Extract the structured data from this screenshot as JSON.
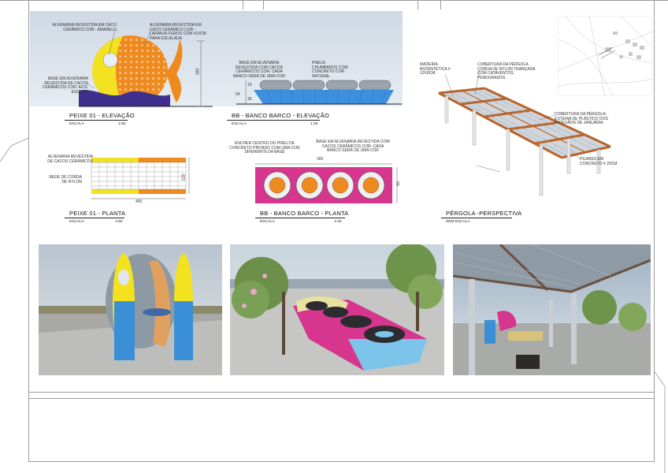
{
  "sheet": {
    "frame_color": "#9a9a9a"
  },
  "peixe_elevacao": {
    "title": "PEIXE 01 - ELEVAÇÃO",
    "scale_label": "ESCALA",
    "scale_value": "1:50",
    "note_eye": "ALVENARIA REVESTIDA EM CACO CERÂMICO COR : AMARELO",
    "note_body": "ALVENARIA REVESTIDA EM CACO CERÂMICO COR : LARANJA FUROS COM #10CM PARA ESCALADA",
    "note_base": "BASE EM ALVENARIA REVESTIDA DE CACOS CERÂMICOS COR: AZUL ESCURO",
    "dim_height": "280"
  },
  "banco_elevacao": {
    "title": "BB - BANCO BARCO - ELEVAÇÃO",
    "scale_label": "ESCALA",
    "scale_value": "1:25",
    "note_base": "BASE EM ALVENARIA REVESTIDA COM CACOS CERÂMICOS COR: CADA BANCO SERÁ DE UMA COR",
    "note_tires": "PNEUS CHUMBADOS COM CONCRETO COR NATURAL",
    "dim_a": "15",
    "dim_b": "54",
    "dim_c": "35"
  },
  "pergola_perspectiva": {
    "title": "PÉRGOLA -PERSPECTIVA",
    "scale_label": "SEM ESCALA",
    "note_wood": "MADEIRA BIOSINTÉTICA # 12X9CM",
    "note_cover": "COBERTURA DA PÉRGOLA CORDA DE NYLON TRANÇADA COM CATAVENTOS PENDURADOS",
    "note_cover2": "COBERTURA DA PÉRGOLA: ESTEIRA DE PLÁSTICO DOS ARTESÃOS DE JANUÁRIA",
    "note_pillars": "PILARES EM CONCRETO # 20CM"
  },
  "peixe_planta": {
    "title": "PEIXE 01 - PLANTA",
    "scale_label": "ESCALA",
    "scale_value": "1:50",
    "note_wall": "ALVENARIA REVESTIDA DE CACOS CERÂMICOS",
    "note_net": "REDE DE CORDA DE NYLON",
    "dim_width": "400",
    "dim_depth": "120"
  },
  "banco_planta": {
    "title": "BB - BANCO BARCO - PLANTA",
    "scale_label": "ESCALA",
    "scale_value": "1:25",
    "note_fill": "ENCHER CENTRO DO PNEU DE CONCRETO PINTADO COM UMA COR DIFERENTE DA BASE",
    "note_base": "BASE EM ALVENARIA REVESTIDA COM CACOS CERÂMICOS COR: CADA BANCO SERÁ DE UMA COR",
    "dim_width": "300",
    "dim_depth": "60"
  },
  "colors": {
    "fish_yellow": "#f2e21f",
    "fish_orange": "#ef8a1e",
    "fish_blue": "#3f2f8c",
    "boat_blue": "#3d8fe0",
    "boat_magenta": "#d6368e",
    "tire_orange": "#ee8a1e",
    "wood": "#b8642d"
  }
}
